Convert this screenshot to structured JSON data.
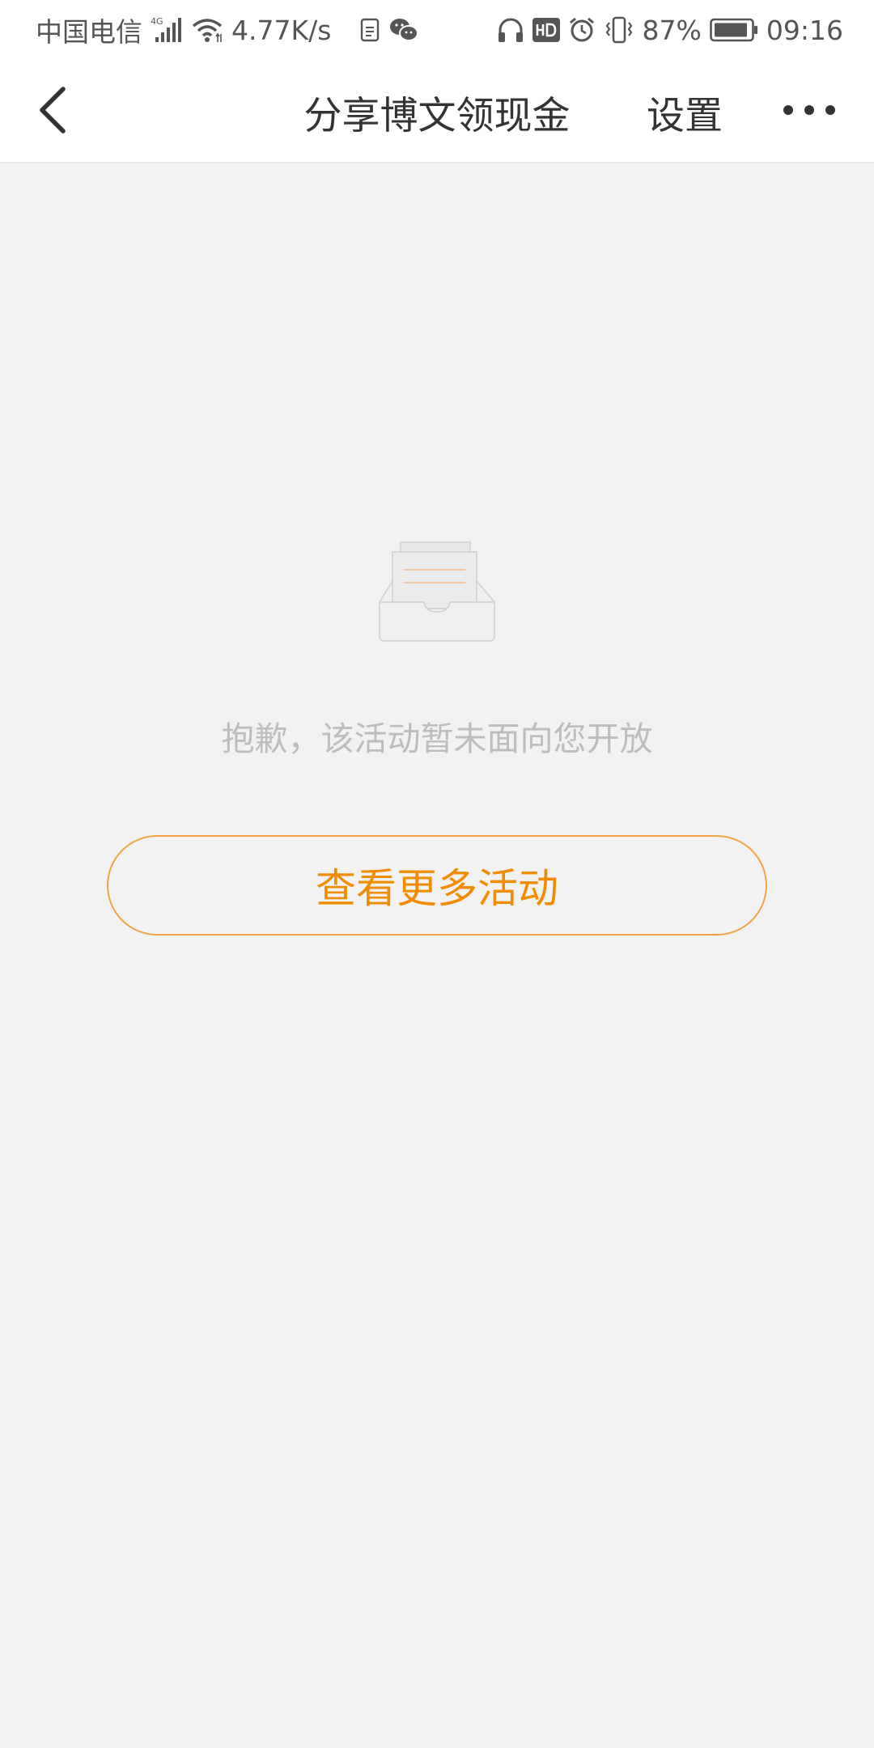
{
  "status_bar": {
    "carrier": "中国电信",
    "network_type": "4G",
    "net_speed": "4.77K/s",
    "battery_percent": "87%",
    "time": "09:16",
    "left_icons": [
      "signal-icon",
      "wifi-icon",
      "clipboard-icon",
      "wechat-icon"
    ],
    "right_icons": [
      "headphones-icon",
      "hd-icon",
      "alarm-icon",
      "vibrate-icon",
      "battery-icon"
    ]
  },
  "nav": {
    "title": "分享博文领现金",
    "settings_label": "设置",
    "back_icon": "chevron-left-icon",
    "more_icon": "more-dots-icon"
  },
  "empty_state": {
    "icon": "empty-inbox-icon",
    "message": "抱歉，该活动暂未面向您开放",
    "button_label": "查看更多活动"
  },
  "colors": {
    "accent": "#f08c00",
    "button_border": "#f0a444",
    "page_background": "#f2f2f2",
    "message_text": "#bdbdbd",
    "title_text": "#333333"
  }
}
